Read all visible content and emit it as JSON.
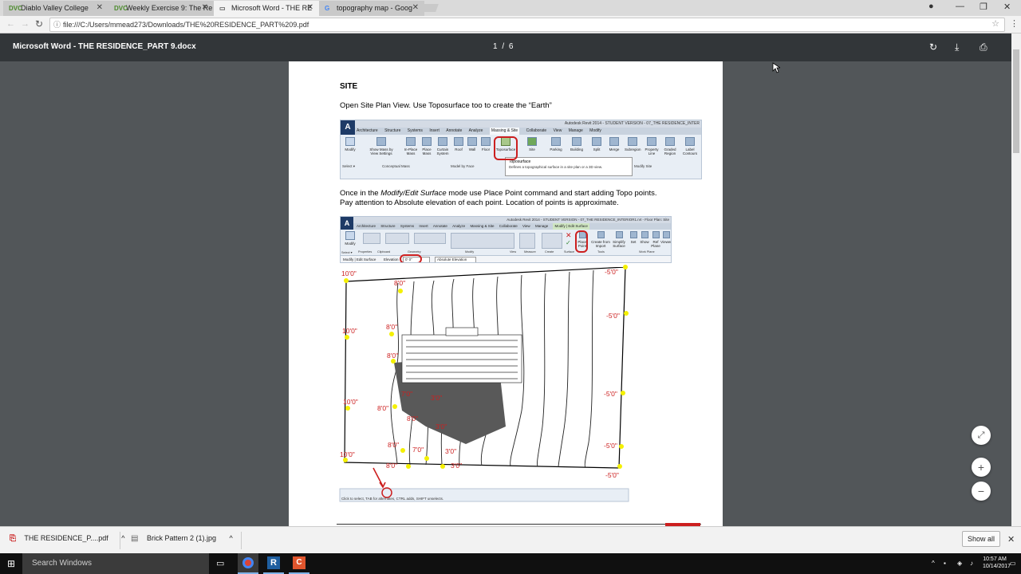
{
  "browser": {
    "tabs": [
      {
        "favicon": "DVC",
        "label": "Diablo Valley College",
        "active": false
      },
      {
        "favicon": "DVC",
        "label": "Weekly Exercise 9: The Re",
        "active": false
      },
      {
        "favicon": "doc",
        "label": "Microsoft Word - THE RE",
        "active": true
      },
      {
        "favicon": "G",
        "label": "topography map - Goog",
        "active": false
      }
    ],
    "url": "file:///C:/Users/mmead273/Downloads/THE%20RESIDENCE_PART%209.pdf"
  },
  "pdf_viewer": {
    "title": "Microsoft Word - THE RESIDENCE_PART 9.docx",
    "current_page": "1",
    "page_separator": "/",
    "total_pages": "6"
  },
  "document": {
    "heading": "SITE",
    "para1": "Open Site Plan View. Use Toposurface too to create the “Earth”",
    "para2_before": "Once in the ",
    "para2_italic": "Modify/Edit Surface",
    "para2_after": " mode use Place Point command and start adding Topo points.",
    "para3": "Pay attention to Absolute elevation of each point. Location of points is approximate.",
    "ribbon1": {
      "app_title": "Autodesk Revit 2014 -  STUDENT VERSION -    07_THE RESIDENCE_INTER",
      "tabs": [
        "Architecture",
        "Structure",
        "Systems",
        "Insert",
        "Annotate",
        "Analyze",
        "Massing & Site",
        "Collaborate",
        "View",
        "Manage",
        "Modify"
      ],
      "buttons": [
        "Modify",
        "Show Mass by View Settings",
        "In-Place Mass",
        "Place Mass",
        "Curtain System",
        "Roof",
        "Wall",
        "Floor",
        "Toposurface",
        "Site",
        "Parking",
        "Building",
        "Split",
        "Merge",
        "Subregion",
        "Property Line",
        "Graded Region",
        "Label Contours"
      ],
      "groups": [
        "Select ▾",
        "Conceptual Mass",
        "Model by Face",
        "Modify Site"
      ],
      "tooltip_title": "Toposurface",
      "tooltip_text": "Defines a topographical surface in a site plan or a 3D view."
    },
    "ribbon2": {
      "app_title": "Autodesk Revit 2014 - STUDENT VERSION -   07_THE RESIDENCE_INTERIOR1.rvt - Floor Plan: Site",
      "tabs": [
        "Architecture",
        "Structure",
        "Systems",
        "Insert",
        "Annotate",
        "Analyze",
        "Massing & Site",
        "Collaborate",
        "View",
        "Manage",
        "Modify | Edit Surface"
      ],
      "groups": [
        "Select ▾",
        "Properties",
        "Clipboard",
        "Geometry",
        "Modify",
        "View",
        "Measure",
        "Create",
        "Surface",
        "Tools",
        "Work Plane"
      ],
      "buttons": [
        "Modify",
        "Place Point",
        "Create from Import",
        "Simplify Surface",
        "Set",
        "Show",
        "Ref Plane",
        "Viewer"
      ],
      "options_bar": [
        "Modify | Edit Surface",
        "Elevation",
        "0' 0\"",
        "Absolute Elevation"
      ]
    },
    "elevation_labels": [
      "10'0\"",
      "8'0\"",
      "-5'0\"",
      "-5'0\"",
      "10'0\"",
      "8'0\"",
      "8'0\"",
      "-5'0\"",
      "10'0\"",
      "8'0\"",
      "3'0\"",
      "3'0\"",
      "7'0\"",
      "8'0\"",
      "-5'0\"",
      "8'0\"",
      "7'0\"",
      "3'0\"",
      "10'0\"",
      "8'0\"",
      "3'0\"",
      "-5'0\""
    ],
    "status_bar": "Click to select, TAB for alternates, CTRL adds, SHIFT unselects."
  },
  "downloads": [
    {
      "name": "THE RESIDENCE_P....pdf",
      "icon": "pdf-icon"
    },
    {
      "name": "Brick Pattern 2 (1).jpg",
      "icon": "image-file-icon"
    }
  ],
  "downloads_show_all": "Show all",
  "taskbar": {
    "search_placeholder": "Search Windows",
    "time": "10:57 AM",
    "date": "10/14/2017"
  },
  "colors": {
    "accent_red": "#cc1f1f",
    "point_yellow": "#f4f000",
    "pdf_toolbar": "#323639"
  }
}
